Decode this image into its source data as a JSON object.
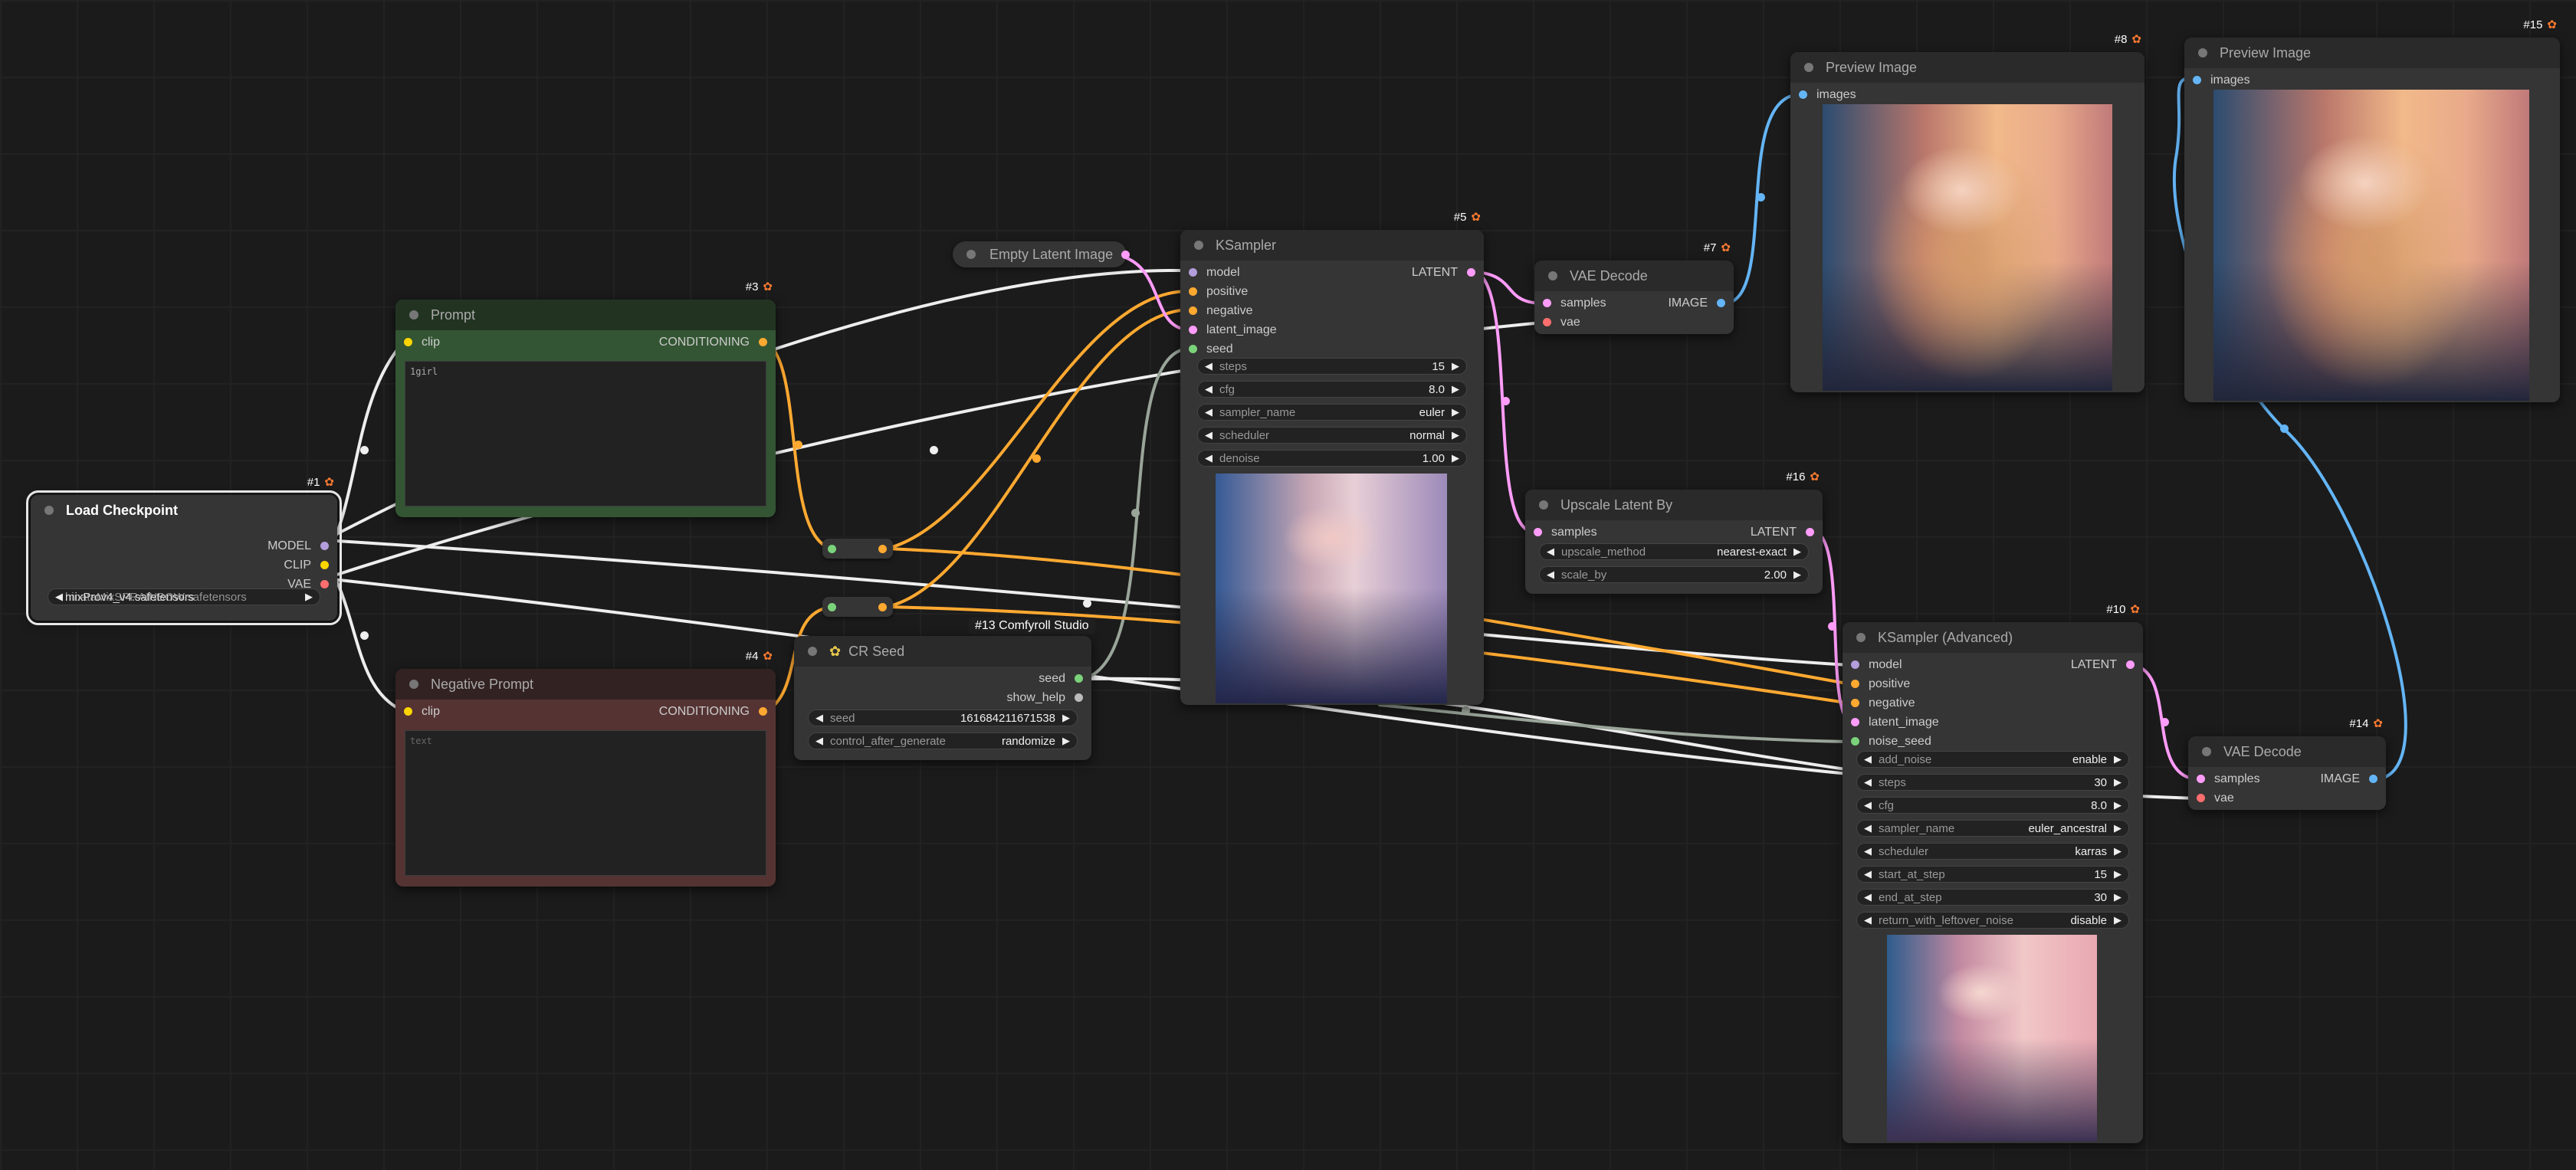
{
  "colors": {
    "model": "#b39ddb",
    "clip": "#ffd500",
    "vae": "#ff6e6e",
    "conditioning": "#ffa931",
    "latent": "#ff9cf9",
    "image": "#64b5f6",
    "int": "#7ad37a",
    "link_white": "#eeeeee",
    "link_gray": "#9aa59a"
  },
  "nodes": {
    "load_checkpoint": {
      "id": "#1",
      "title": "Load Checkpoint",
      "outputs": [
        "MODEL",
        "CLIP",
        "VAE"
      ],
      "ckpt_name": "mixProv4_v4.safetensors",
      "ckpt_name_overlap": "hinataMixSPRAINBOW.safetensors"
    },
    "prompt": {
      "id": "#3",
      "title": "Prompt",
      "input": "clip",
      "output": "CONDITIONING",
      "text": "1girl"
    },
    "negative_prompt": {
      "id": "#4",
      "title": "Negative Prompt",
      "input": "clip",
      "output": "CONDITIONING",
      "placeholder": "text"
    },
    "empty_latent": {
      "title": "Empty Latent Image"
    },
    "ksampler": {
      "id": "#5",
      "title": "KSampler",
      "inputs": [
        "model",
        "positive",
        "negative",
        "latent_image",
        "seed"
      ],
      "output": "LATENT",
      "widgets": [
        {
          "label": "steps",
          "value": "15"
        },
        {
          "label": "cfg",
          "value": "8.0"
        },
        {
          "label": "sampler_name",
          "value": "euler"
        },
        {
          "label": "scheduler",
          "value": "normal"
        },
        {
          "label": "denoise",
          "value": "1.00"
        }
      ]
    },
    "cr_seed": {
      "group_label": "#13 Comfyroll Studio",
      "title": "CR Seed",
      "outputs": [
        "seed",
        "show_help"
      ],
      "widgets": [
        {
          "label": "seed",
          "value": "161684211671538"
        },
        {
          "label": "control_after_generate",
          "value": "randomize"
        }
      ]
    },
    "vae_decode_7": {
      "id": "#7",
      "title": "VAE Decode",
      "inputs": [
        "samples",
        "vae"
      ],
      "output": "IMAGE"
    },
    "preview_8": {
      "id": "#8",
      "title": "Preview Image",
      "input": "images"
    },
    "preview_15": {
      "id": "#15",
      "title": "Preview Image",
      "input": "images"
    },
    "upscale_latent": {
      "id": "#16",
      "title": "Upscale Latent By",
      "input": "samples",
      "output": "LATENT",
      "widgets": [
        {
          "label": "upscale_method",
          "value": "nearest-exact"
        },
        {
          "label": "scale_by",
          "value": "2.00"
        }
      ]
    },
    "ksampler_adv": {
      "id": "#10",
      "title": "KSampler (Advanced)",
      "inputs": [
        "model",
        "positive",
        "negative",
        "latent_image",
        "noise_seed"
      ],
      "output": "LATENT",
      "widgets": [
        {
          "label": "add_noise",
          "value": "enable"
        },
        {
          "label": "steps",
          "value": "30"
        },
        {
          "label": "cfg",
          "value": "8.0"
        },
        {
          "label": "sampler_name",
          "value": "euler_ancestral"
        },
        {
          "label": "scheduler",
          "value": "karras"
        },
        {
          "label": "start_at_step",
          "value": "15"
        },
        {
          "label": "end_at_step",
          "value": "30"
        },
        {
          "label": "return_with_leftover_noise",
          "value": "disable"
        }
      ]
    },
    "vae_decode_14": {
      "id": "#14",
      "title": "VAE Decode",
      "inputs": [
        "samples",
        "vae"
      ],
      "output": "IMAGE"
    }
  }
}
